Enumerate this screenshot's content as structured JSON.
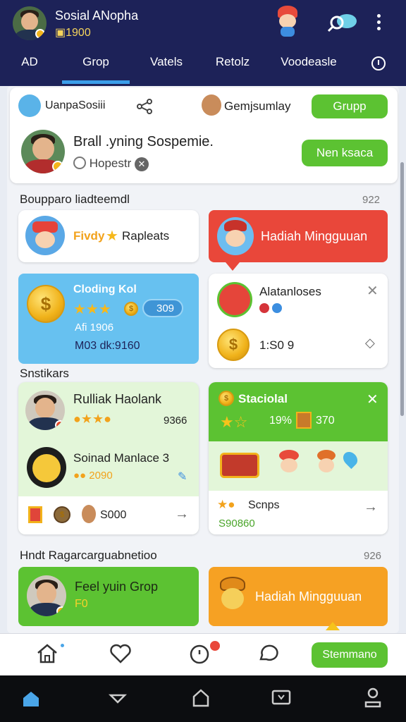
{
  "header": {
    "username": "Sosial ANopha",
    "coins": "1900",
    "tabs": [
      {
        "label": "AD"
      },
      {
        "label": "Grop"
      },
      {
        "label": "Vatels"
      },
      {
        "label": "Retolz"
      },
      {
        "label": "Voodeasle"
      }
    ],
    "active_tab": "Grop"
  },
  "group_card": {
    "left_label": "UanpaSosiii",
    "middle_label": "Gemjsumlay",
    "group_button": "Grupp",
    "player_name": "Brall .yning Sospemie.",
    "player_sub": "Hopestr",
    "action_button": "Nen ksaca"
  },
  "section1": {
    "title": "Boupparo liadteemdl",
    "count": "922"
  },
  "cards1": {
    "left_small_label": "Fivdy",
    "left_small_label2": "Rapleats",
    "promo_red": "Hadiah Mingguuan",
    "blue_title": "Cloding Kol",
    "blue_value": "309",
    "blue_line2": "Afi 1906",
    "blue_line3": "M03 dk:9160",
    "right_title": "Alatanloses",
    "right_value": "1:S0 9"
  },
  "section2": {
    "title": "Snstikars"
  },
  "cards2": {
    "player1": "Rulliak Haolank",
    "player1_score": "9366",
    "player2": "Soinad Manlace 3",
    "player2_score": "2090",
    "footer_value": "S000",
    "stat_title": "Staciolal",
    "stat_percent": "19%",
    "stat_value": "370",
    "stat_footer": "Scnps",
    "stat_footer_value": "S90860"
  },
  "section3": {
    "title": "Hndt Ragarcarguabnetioo",
    "count": "926"
  },
  "cards3": {
    "green_title": "Feel yuin Grop",
    "green_sub": "F0",
    "orange_promo": "Hadiah Mingguuan"
  },
  "bottom_bar": {
    "action_button": "Stemmano"
  },
  "colors": {
    "header": "#1d2258",
    "green": "#5cc232",
    "red": "#e9473a",
    "orange": "#f6a123",
    "blue": "#67c1f0"
  }
}
